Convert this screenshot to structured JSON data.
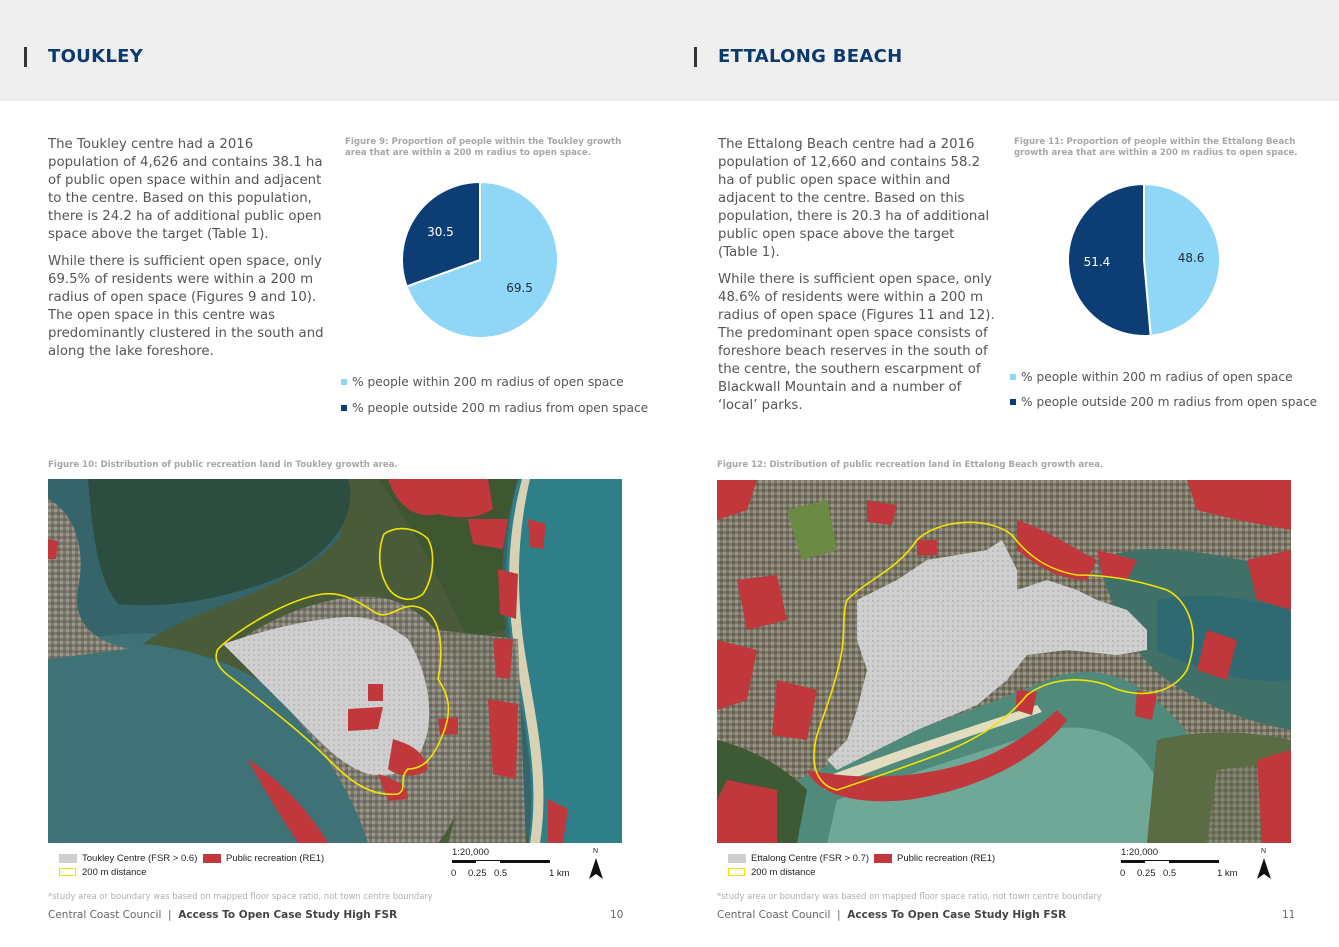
{
  "left": {
    "section_title": "TOUKLEY",
    "paragraphs": [
      "The Toukley centre had a 2016 population of 4,626 and contains 38.1 ha of public open space within and adjacent to the centre. Based on this population, there is 24.2 ha of additional public open space above the target (Table 1).",
      "While there is sufficient open space, only 69.5% of residents were within a 200 m radius of open space (Figures 9 and 10). The open space in this centre was predominantly clustered in the south and along the lake foreshore."
    ],
    "pie_caption": "Figure 9: Proportion of people within the Toukley growth area that are within a 200 m radius to open space.",
    "map_caption": "Figure 10: Distribution of public recreation land in Toukley growth area.",
    "map_legend": {
      "centre": "Toukley Centre (FSR > 0.6)",
      "recreation": "Public recreation (RE1)",
      "distance": "200 m distance"
    },
    "scale": {
      "ratio": "1:20,000",
      "t0": "0",
      "t1": "0.25",
      "t2": "0.5",
      "t3": "1 km"
    },
    "north": "N",
    "note": "*study area or boundary was based on mapped floor space ratio, not town centre boundary",
    "footer_org": "Central Coast Council",
    "footer_sep": "|",
    "footer_doc": "Access To Open Case Study High FSR",
    "page_number": "10"
  },
  "right": {
    "section_title": "ETTALONG BEACH",
    "paragraphs": [
      "The Ettalong Beach centre had a 2016 population of 12,660 and contains 58.2 ha of public open space within and adjacent to the centre. Based on this population, there is 20.3 ha of additional public open space above the target (Table 1).",
      "While there is sufficient open space, only 48.6% of residents were within a 200 m radius of open space (Figures 11 and 12). The predominant open space consists of foreshore beach reserves in the south of the centre, the southern escarpment of Blackwall Mountain and a number of ‘local’ parks."
    ],
    "pie_caption": "Figure 11: Proportion of people within the Ettalong Beach growth area that are within a 200 m radius to open space.",
    "map_caption": "Figure 12: Distribution of public recreation land in Ettalong Beach growth area.",
    "map_legend": {
      "centre": "Ettalong Centre (FSR > 0.7)",
      "recreation": "Public recreation (RE1)",
      "distance": "200 m distance"
    },
    "scale": {
      "ratio": "1:20,000",
      "t0": "0",
      "t1": "0.25",
      "t2": "0.5",
      "t3": "1 km"
    },
    "north": "N",
    "note": "*study area or boundary was based on mapped floor space ratio, not town centre boundary",
    "footer_org": "Central Coast Council",
    "footer_sep": "|",
    "footer_doc": "Access To Open Case Study High FSR",
    "page_number": "11"
  },
  "chart_data": [
    {
      "type": "pie",
      "title": "Figure 9: Proportion of people within the Toukley growth area that are within a 200 m radius to open space.",
      "categories": [
        "% people within 200 m radius of open space",
        "% people outside 200 m radius from open space"
      ],
      "values": [
        69.5,
        30.5
      ],
      "colors": [
        "#8fd6f7",
        "#0c3d75"
      ],
      "legend": "bottom"
    },
    {
      "type": "pie",
      "title": "Figure 11: Proportion of people within the Ettalong Beach growth area that are within a 200 m radius to open space.",
      "categories": [
        "% people within 200 m radius of open space",
        "% people outside 200 m radius from open space"
      ],
      "values": [
        48.6,
        51.4
      ],
      "colors": [
        "#8fd6f7",
        "#0c3d75"
      ],
      "legend": "bottom"
    }
  ],
  "colors": {
    "title": "#0b3a6e",
    "recreation": "#c0383c",
    "boundary": "#f2e400",
    "centre": "#cfcfcf"
  }
}
